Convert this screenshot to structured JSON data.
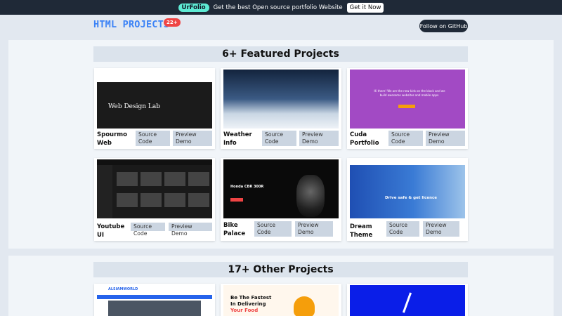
{
  "banner": {
    "tag": "UrFolio",
    "text": "Get the best Open source portfolio Website",
    "cta": "Get it Now"
  },
  "header": {
    "title": "HTML PROJECTS",
    "count_badge": "22+",
    "github_button": "Follow on GitHub"
  },
  "featured": {
    "heading": "6+ Featured Projects",
    "projects": [
      {
        "name": "Spourmo Web",
        "source": "Source Code",
        "demo": "Preview Demo",
        "thumb_text": "Web Design Lab"
      },
      {
        "name": "Weather Info",
        "source": "Source Code",
        "demo": "Preview Demo"
      },
      {
        "name": "Cuda Portfolio",
        "source": "Source Code",
        "demo": "Preview Demo",
        "thumb_text": "Hi there! We are the new kids on the block and we build awesome websites and mobile apps."
      },
      {
        "name": "Youtube UI",
        "source": "Source Code",
        "demo": "Preview Demo"
      },
      {
        "name": "Bike Palace",
        "source": "Source Code",
        "demo": "Preview Demo",
        "thumb_text": "Honda CBR 300R"
      },
      {
        "name": "Dream Theme",
        "source": "Source Code",
        "demo": "Preview Demo",
        "thumb_text": "Drive safe & get licence"
      }
    ]
  },
  "other": {
    "heading": "17+ Other Projects",
    "projects": [
      {
        "thumb_text": "ALSIAMWORLD"
      },
      {
        "thumb_line1": "Be The Fastest",
        "thumb_line2": "In Delivering",
        "thumb_line3": "Your Food"
      },
      {}
    ]
  },
  "colors": {
    "accent_blue": "#3b82f6",
    "badge_red": "#ef4444",
    "dark": "#1f2937",
    "button_bg": "#cbd5e1"
  }
}
